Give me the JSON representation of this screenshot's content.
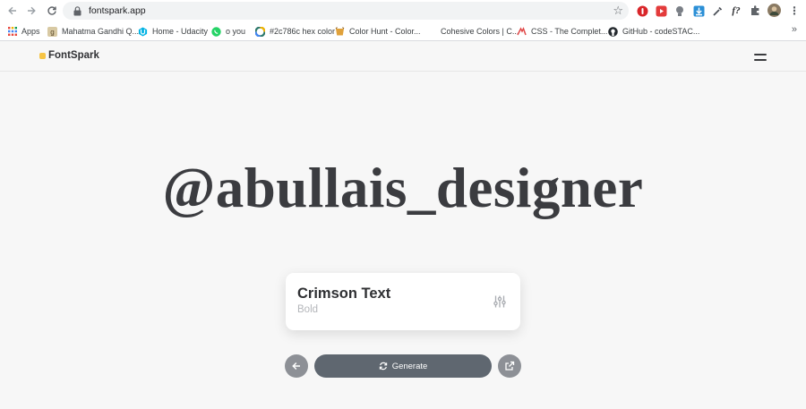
{
  "browser": {
    "url": "fontspark.app",
    "bookmarks": [
      {
        "label": "Apps",
        "icon": "apps-grid-icon"
      },
      {
        "label": "Mahatma Gandhi Q...",
        "icon": "bookmark-g-icon"
      },
      {
        "label": "Home - Udacity",
        "icon": "udacity-icon"
      },
      {
        "label": "o you",
        "icon": "whatsapp-icon"
      },
      {
        "label": "#2c786c hex color",
        "icon": "color-wheel-icon"
      },
      {
        "label": "Color Hunt - Color...",
        "icon": "color-hunt-icon"
      },
      {
        "label": "Cohesive Colors | C...",
        "icon": ""
      },
      {
        "label": "CSS - The Complet...",
        "icon": "css-icon"
      },
      {
        "label": "GitHub - codeSTAC...",
        "icon": "github-icon"
      }
    ],
    "bookmarks_more": "»"
  },
  "app": {
    "brand": "FontSpark",
    "accent_color": "#f6c445"
  },
  "preview": {
    "text": "@abullais_designer"
  },
  "font_card": {
    "name": "Crimson Text",
    "weight": "Bold"
  },
  "controls": {
    "generate_label": "Generate"
  }
}
